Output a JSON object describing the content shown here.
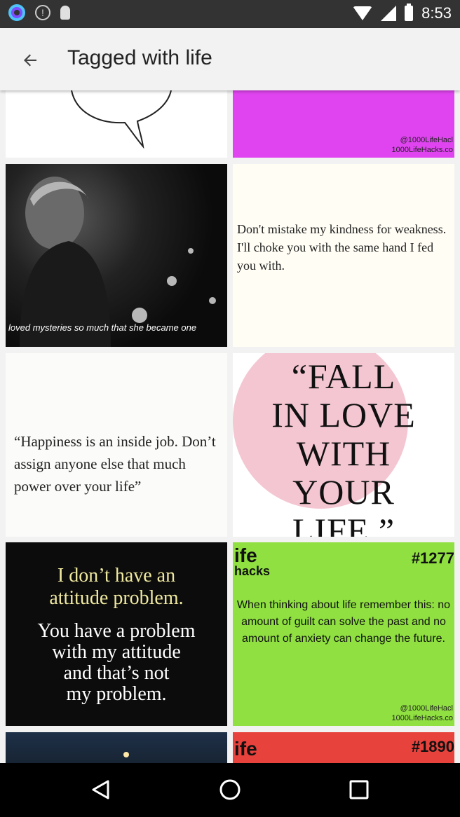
{
  "status_bar": {
    "time": "8:53",
    "icons": [
      "ring-icon",
      "info-circle-icon",
      "bulb-icon",
      "wifi-icon",
      "signal-icon",
      "battery-icon"
    ]
  },
  "app_bar": {
    "title": "Tagged with life",
    "back_icon": "arrow-left-icon"
  },
  "tiles": {
    "magenta": {
      "credit_1": "@1000LifeHacl",
      "credit_2": "1000LifeHacks.co",
      "color": "#e044f0"
    },
    "photo": {
      "caption": "loved mysteries so much that she became one"
    },
    "kindness": {
      "quote": "Don't mistake my kindness for weakness. I'll choke you with the same hand I fed you with."
    },
    "happiness": {
      "quote": "“Happiness is an inside job. Don’t assign anyone else that much power over your life”"
    },
    "fall": {
      "line1": "“FALL",
      "line2": "IN LOVE",
      "line3": "WITH",
      "line4": "YOUR",
      "line5": "LIFE.”"
    },
    "attitude": {
      "line1": "I don’t have an",
      "line2": "attitude problem.",
      "line3": "You have a problem",
      "line4": "with my attitude",
      "line5": "and that’s not",
      "line6": "my problem."
    },
    "green": {
      "brand": "ife",
      "brand_sub": "hacks",
      "number": "#1277",
      "quote": "When thinking about life remember this: no amount of guilt can solve the past and no amount of anxiety can change the future.",
      "credit_1": "@1000LifeHacl",
      "credit_2": "1000LifeHacks.co",
      "color": "#8fe040"
    },
    "red": {
      "brand": "ife",
      "number": "#1890",
      "color": "#e8423c"
    }
  },
  "nav_bar": {
    "back": "back-triangle-icon",
    "home": "home-circle-icon",
    "recents": "recents-square-icon"
  }
}
